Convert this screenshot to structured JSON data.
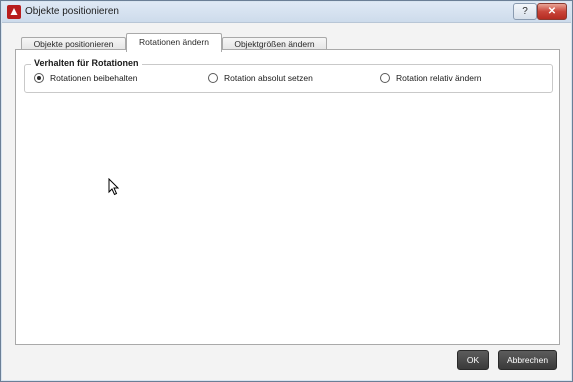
{
  "window": {
    "title": "Objekte positionieren",
    "help_label": "?",
    "close_label": "✕"
  },
  "tabs": [
    {
      "label": "Objekte positionieren",
      "active": false
    },
    {
      "label": "Rotationen ändern",
      "active": true
    },
    {
      "label": "Objektgrößen ändern",
      "active": false
    }
  ],
  "group": {
    "title": "Verhalten für Rotationen",
    "options": [
      {
        "label": "Rotationen beibehalten",
        "selected": true
      },
      {
        "label": "Rotation absolut setzen",
        "selected": false
      },
      {
        "label": "Rotation relativ ändern",
        "selected": false
      }
    ]
  },
  "buttons": {
    "ok": "OK",
    "cancel": "Abbrechen"
  }
}
